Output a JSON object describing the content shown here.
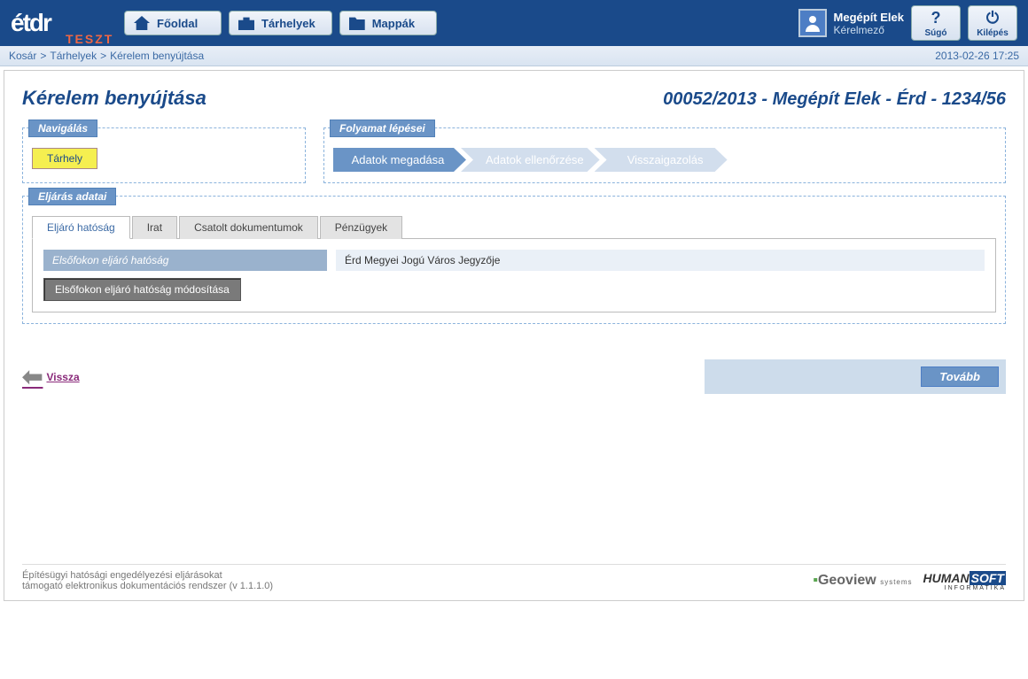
{
  "header": {
    "logo_text": "étdr",
    "logo_overlay": "TESZT",
    "nav": {
      "home": "Főoldal",
      "storage": "Tárhelyek",
      "folders": "Mappák"
    },
    "user": {
      "name": "Megépít Elek",
      "role": "Kérelmező"
    },
    "actions": {
      "help_icon": "?",
      "help": "Súgó",
      "logout": "Kilépés"
    }
  },
  "breadcrumb": {
    "items": [
      "Kosár",
      "Tárhelyek",
      "Kérelem benyújtása"
    ],
    "timestamp": "2013-02-26 17:25"
  },
  "page": {
    "title": "Kérelem benyújtása",
    "subtitle": "00052/2013 - Megépít Elek - Érd - 1234/56"
  },
  "nav_panel": {
    "legend": "Navigálás",
    "storage_btn": "Tárhely"
  },
  "process_panel": {
    "legend": "Folyamat lépései",
    "steps": [
      "Adatok megadása",
      "Adatok ellenőrzése",
      "Visszaigazolás"
    ]
  },
  "data_panel": {
    "legend": "Eljárás adatai",
    "tabs": [
      "Eljáró hatóság",
      "Irat",
      "Csatolt dokumentumok",
      "Pénzügyek"
    ],
    "active_tab": 0,
    "fields": {
      "authority_label": "Elsőfokon eljáró hatóság",
      "authority_value": "Érd Megyei Jogú Város Jegyzője",
      "edit_btn": "Elsőfokon eljáró hatóság módosítása"
    }
  },
  "foot_nav": {
    "back": "Vissza",
    "forward": "Tovább"
  },
  "footer": {
    "line1": "Építésügyi hatósági engedélyezési eljárásokat",
    "line2": "támogató elektronikus dokumentációs rendszer (v 1.1.1.0)",
    "geoview": "Geoview",
    "geoview_sub": "systems",
    "humansoft_pre": "HUMAN",
    "humansoft_post": "SOFT",
    "humansoft_sub": "INFORMATIKA"
  }
}
